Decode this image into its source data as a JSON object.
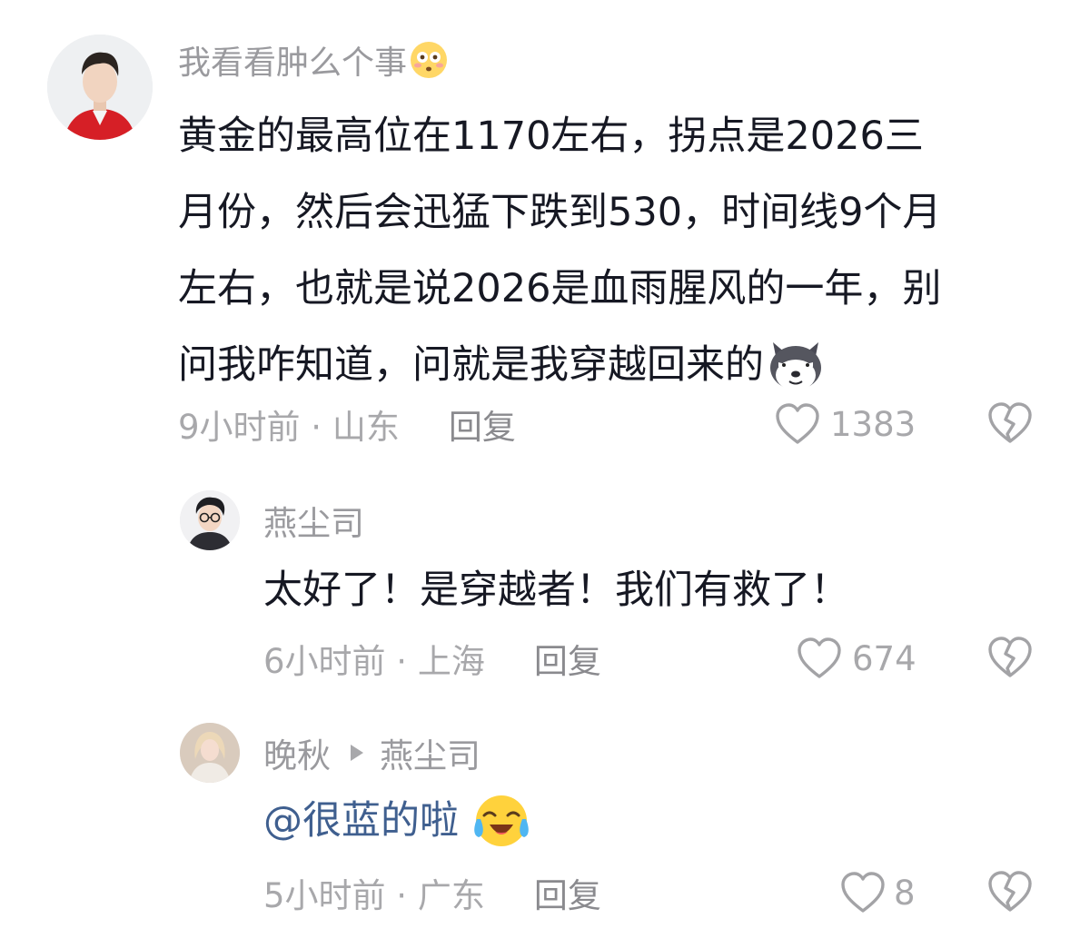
{
  "comments": [
    {
      "author": "我看看肿么个事",
      "author_emoji": "flushed-face-emoji",
      "lines": [
        "黄金的最高位在1170左右，拐点是2026三",
        "月份，然后会迅猛下跌到530，时间线9个月",
        "左右，也就是说2026是血雨腥风的一年，别",
        "问我咋知道，问就是我穿越回来的"
      ],
      "trailing_emoji": "husky-dog-emoji",
      "time_location": "9小时前 · 山东",
      "reply_label": "回复",
      "likes": "1383"
    },
    {
      "author": "燕尘司",
      "text": "太好了！是穿越者！我们有救了！",
      "time_location": "6小时前 · 上海",
      "reply_label": "回复",
      "likes": "674"
    },
    {
      "author": "晚秋",
      "reply_to": "燕尘司",
      "mention": "@很蓝的啦",
      "trailing_emoji": "crying-laughing-face-emoji",
      "time_location": "5小时前 · 广东",
      "reply_label": "回复",
      "likes": "8"
    }
  ],
  "icons": {
    "like": "heart-outline-icon",
    "dislike": "broken-heart-icon",
    "reply_arrow": "play-triangle-icon"
  },
  "colors": {
    "text": "#161823",
    "meta": "#a8a8ab",
    "mention": "#3f5f8f"
  }
}
